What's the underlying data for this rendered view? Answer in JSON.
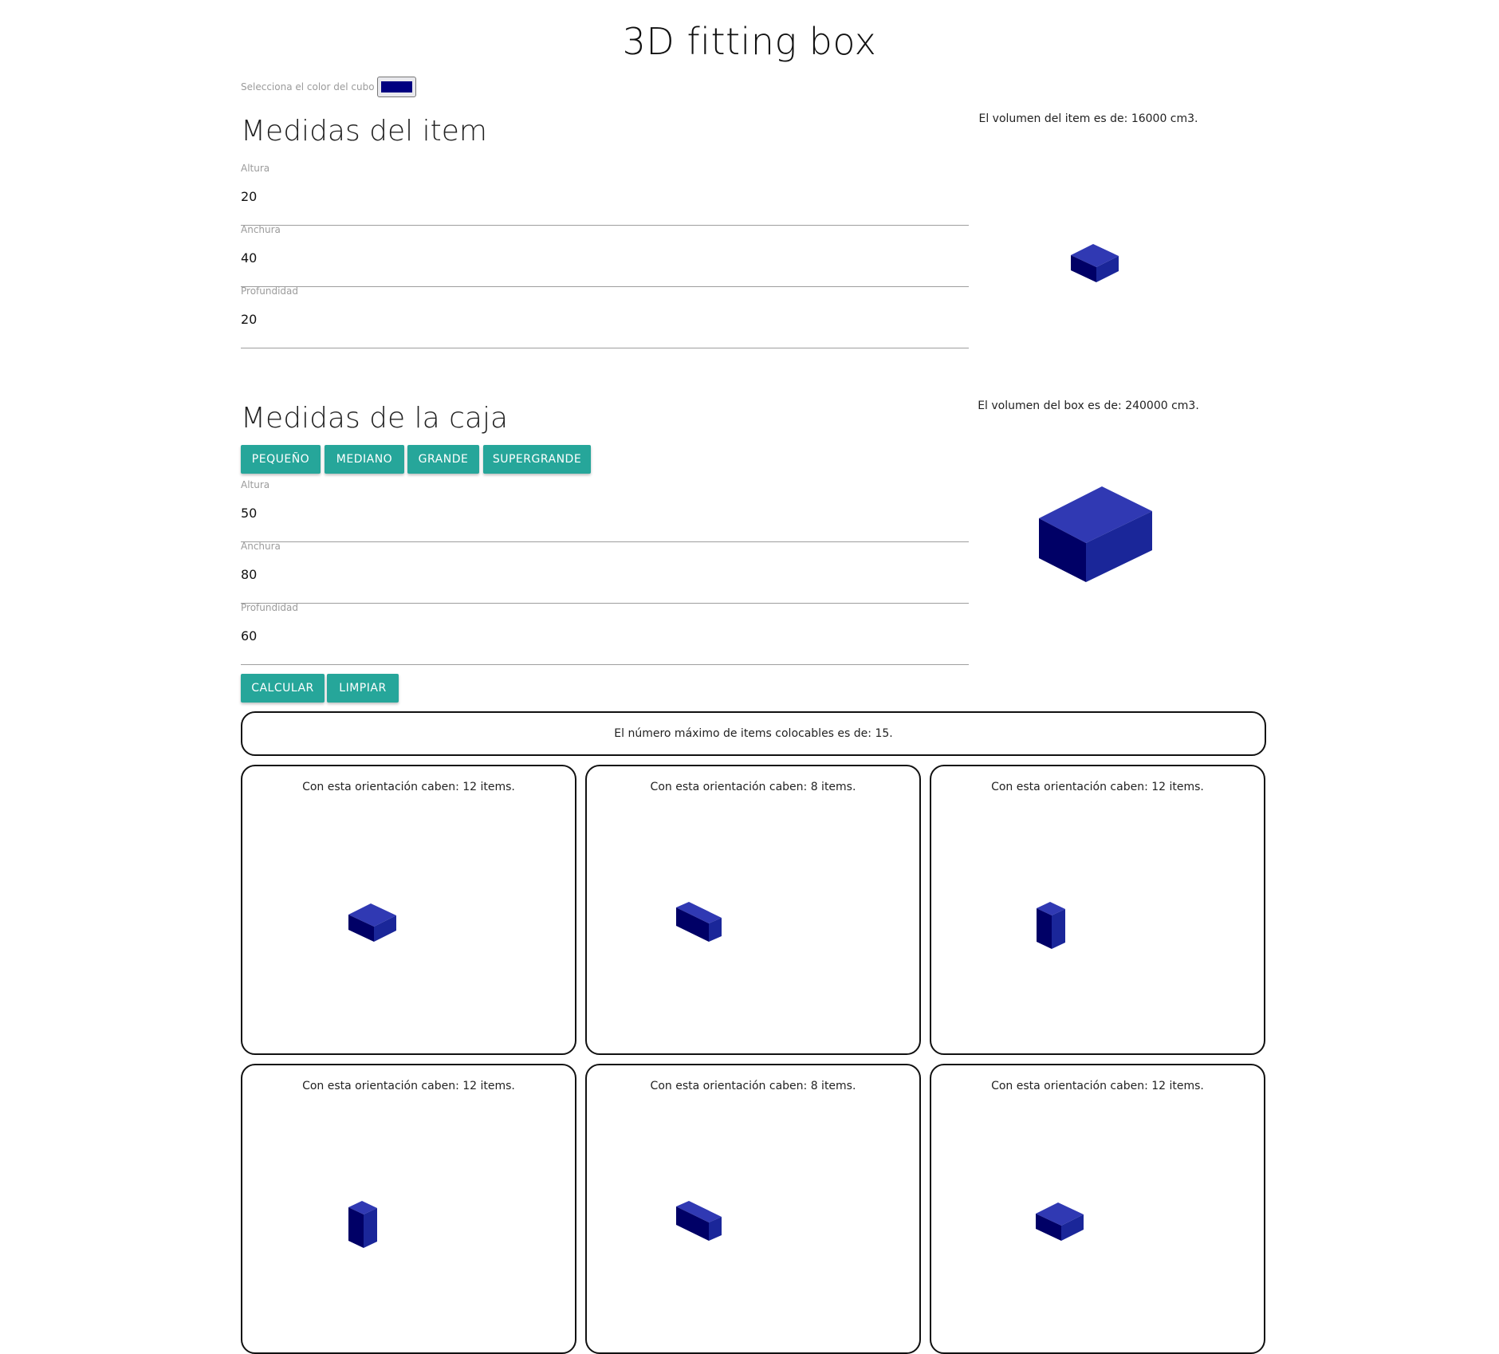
{
  "page": {
    "title": "3D fitting box",
    "color_picker": {
      "label": "Selecciona el color del cubo",
      "value": "#000080"
    },
    "cube_colors": {
      "top": "#3039b3",
      "left": "#000066",
      "right": "#1a2699"
    }
  },
  "item": {
    "heading": "Medidas del item",
    "fields": [
      {
        "label": "Altura",
        "value": "20"
      },
      {
        "label": "Anchura",
        "value": "40"
      },
      {
        "label": "Profundidad",
        "value": "20"
      }
    ],
    "volume_text": "El volumen del item es de: 16000 cm3."
  },
  "box": {
    "heading": "Medidas de la caja",
    "preset_buttons": [
      "PEQUEÑO",
      "MEDIANO",
      "GRANDE",
      "SUPERGRANDE"
    ],
    "fields": [
      {
        "label": "Altura",
        "value": "50"
      },
      {
        "label": "Anchura",
        "value": "80"
      },
      {
        "label": "Profundidad",
        "value": "60"
      }
    ],
    "volume_text": "El volumen del box es de: 240000 cm3."
  },
  "actions": {
    "calculate": "CALCULAR",
    "clear": "LIMPIAR"
  },
  "results": {
    "max_text": "El número máximo de items colocables es de: 15.",
    "orientations": [
      {
        "text": "Con esta orientación caben: 12 items.",
        "dims": [
          20,
          40,
          20
        ]
      },
      {
        "text": "Con esta orientación caben: 8 items.",
        "dims": [
          20,
          20,
          40
        ]
      },
      {
        "text": "Con esta orientación caben: 12 items.",
        "dims": [
          40,
          20,
          20
        ]
      },
      {
        "text": "Con esta orientación caben: 12 items.",
        "dims": [
          40,
          20,
          20
        ]
      },
      {
        "text": "Con esta orientación caben: 8 items.",
        "dims": [
          20,
          20,
          40
        ]
      },
      {
        "text": "Con esta orientación caben: 12 items.",
        "dims": [
          20,
          40,
          20
        ]
      }
    ]
  }
}
